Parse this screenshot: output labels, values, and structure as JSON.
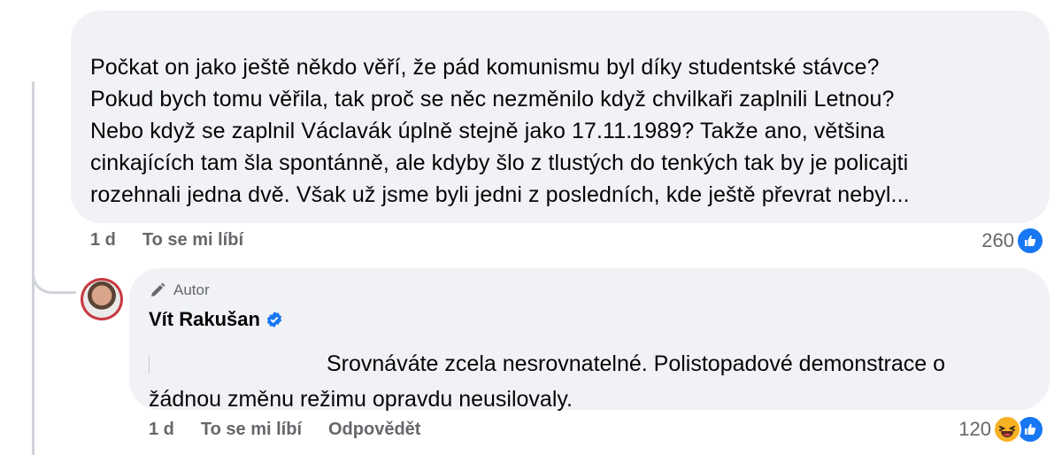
{
  "comment": {
    "text": "Počkat on jako ještě někdo věří, že pád komunismu byl díky studentské stávce?\nPokud bych tomu věřila, tak proč se něc nezměnilo když chvilkaři zaplnili Letnou?\nNebo když se zaplnil Václavák úplně stejně jako 17.11.1989? Takže ano, většina\ncinkajících tam šla spontánně, ale kdyby šlo z tlustých do tenkých tak by je policajti\nrozehnali jedna dvě. Však už jsme byli jedni z posledních, kde ještě převrat nebyl...",
    "time": "1 d",
    "like_label": "To se mi líbí",
    "reaction_count": "260",
    "reaction_icon": "like-icon"
  },
  "reply": {
    "author_badge": "Autor",
    "author_name": "Vít Rakušan",
    "verified_icon": "verified-badge-icon",
    "text_line1": "Srovnáváte zcela nesrovnatelné. Polistopadové demonstrace o",
    "text_line2": "žádnou změnu režimu opravdu neusilovaly.",
    "time": "1 d",
    "like_label": "To se mi líbí",
    "reply_label": "Odpovědět",
    "reaction_count": "120",
    "reaction_icons": [
      "haha-icon",
      "like-icon"
    ]
  },
  "colors": {
    "bubble_bg": "#f0f2f5",
    "meta_text": "#65676b",
    "like_blue": "#1877f2",
    "thread_line": "#d0d3d8"
  }
}
